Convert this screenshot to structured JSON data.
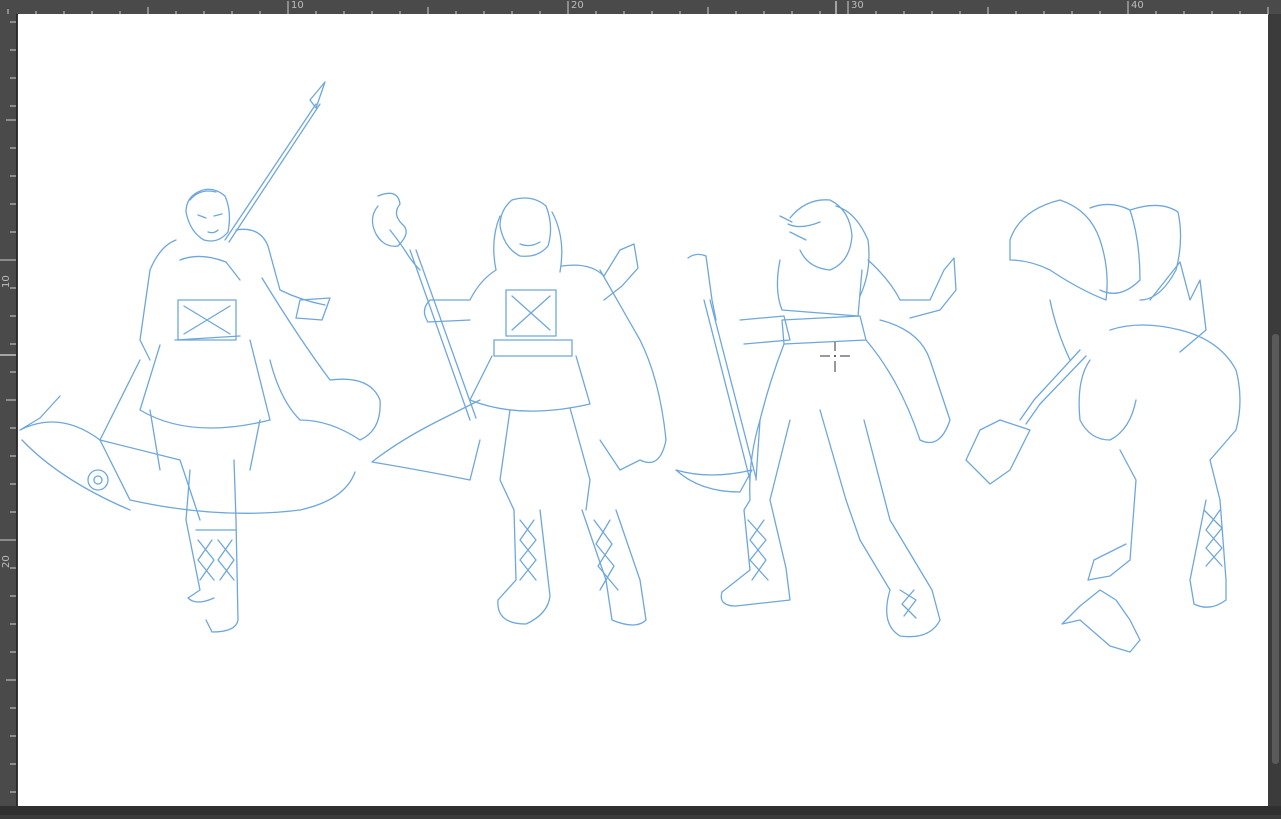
{
  "rulers": {
    "top_labels": [
      "10",
      "20",
      "30",
      "40"
    ],
    "left_labels": [
      "10",
      "20"
    ]
  },
  "canvas": {
    "subject": "sketch-of-four-characters",
    "line_color": "#6ea7dc",
    "background": "#ffffff"
  },
  "cursor": {
    "icon": "crosshair-cursor-icon"
  }
}
